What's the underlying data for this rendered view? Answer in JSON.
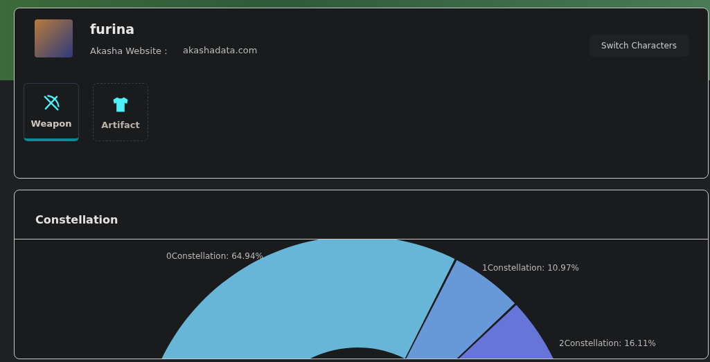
{
  "profile": {
    "name": "furina",
    "website_label": "Akasha Website：",
    "website": "akashadata.com",
    "switch_button": "Switch Characters"
  },
  "tabs": [
    {
      "label": "Weapon",
      "kind": "weapon",
      "selected": true
    },
    {
      "label": "Artifact",
      "kind": "artifact",
      "selected": false
    }
  ],
  "constellation": {
    "title": "Constellation",
    "chart_data": {
      "type": "donut",
      "categories": [
        "0Constellation: 64.94%",
        "1Constellation: 10.97%",
        "2Constellation: 16.11%"
      ],
      "values": [
        64.94,
        10.97,
        16.11
      ],
      "colors": [
        "#67b6d8",
        "#6798d8",
        "#6774d8"
      ]
    }
  }
}
